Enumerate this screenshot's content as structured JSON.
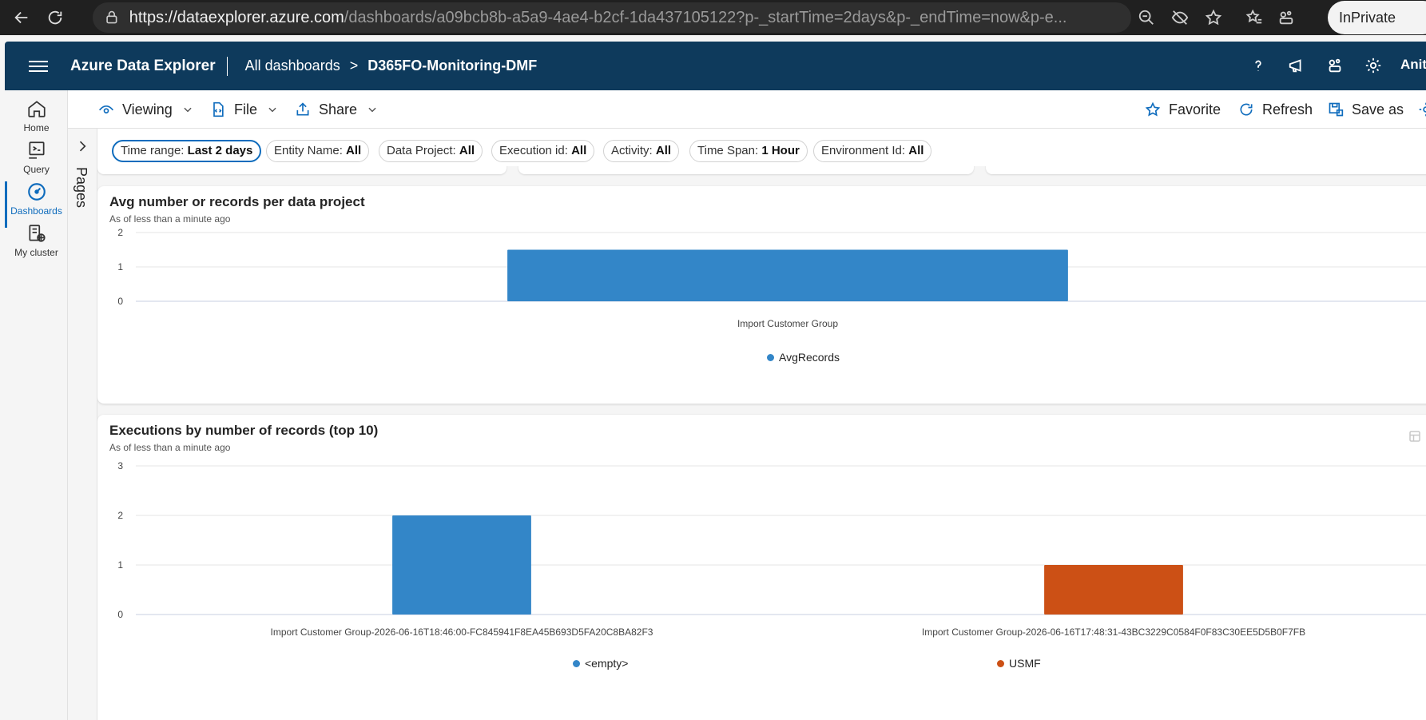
{
  "browser": {
    "url_host": "https://dataexplorer.azure.com",
    "url_path": "/dashboards/a09bcb8b-a5a9-4ae4-b2cf-1da437105122?p-_startTime=2days&p-_endTime=now&p-e...",
    "inprivate_label": "InPrivate"
  },
  "header": {
    "app_name": "Azure Data Explorer",
    "crumb_all": "All dashboards",
    "crumb_sep": ">",
    "crumb_current": "D365FO-Monitoring-DMF",
    "user_name": "Anith"
  },
  "rail": {
    "items": [
      {
        "label": "Home",
        "icon": "home-icon"
      },
      {
        "label": "Query",
        "icon": "query-icon"
      },
      {
        "label": "Dashboards",
        "icon": "dashboard-gauge-icon"
      },
      {
        "label": "My cluster",
        "icon": "cluster-icon"
      }
    ]
  },
  "pages": {
    "label": "Pages"
  },
  "toolbar": {
    "viewing": "Viewing",
    "file": "File",
    "share": "Share",
    "favorite": "Favorite",
    "refresh": "Refresh",
    "save_as": "Save as"
  },
  "params": [
    {
      "name": "Time range:",
      "value": "Last 2 days",
      "selected": true
    },
    {
      "name": "Entity Name:",
      "value": "All"
    },
    {
      "name": "Data Project:",
      "value": "All"
    },
    {
      "name": "Execution id:",
      "value": "All"
    },
    {
      "name": "Activity:",
      "value": "All"
    },
    {
      "name": "Time Span:",
      "value": "1 Hour"
    },
    {
      "name": "Environment Id:",
      "value": "All"
    }
  ],
  "colors": {
    "accent": "#0f6cbd",
    "header_bg": "#0e3a5c",
    "series_blue": "#3386c8",
    "series_orange": "#cc5015"
  },
  "chart_data": [
    {
      "type": "bar",
      "title": "Avg number or records per data project",
      "subtitle": "As of less than a minute ago",
      "categories": [
        "Import Customer Group"
      ],
      "series": [
        {
          "name": "AvgRecords",
          "values": [
            1.5
          ],
          "color": "#3386c8"
        }
      ],
      "ylim": [
        0,
        2
      ],
      "yticks": [
        0,
        1,
        2
      ],
      "grid": true,
      "legend": "bottom"
    },
    {
      "type": "bar",
      "title": "Executions by number of records (top 10)",
      "subtitle": "As of less than a minute ago",
      "categories": [
        "Import Customer Group-2026-06-16T18:46:00-FC845941F8EA45B693D5FA20C8BA82F3",
        "Import Customer Group-2026-06-16T17:48:31-43BC3229C0584F0F83C30EE5D5B0F7FB"
      ],
      "series": [
        {
          "name": "<empty>",
          "values": [
            2,
            null
          ],
          "color": "#3386c8"
        },
        {
          "name": "USMF",
          "values": [
            null,
            1
          ],
          "color": "#cc5015"
        }
      ],
      "ylim": [
        0,
        3
      ],
      "yticks": [
        0,
        1,
        2,
        3
      ],
      "grid": true,
      "legend": "bottom"
    }
  ]
}
